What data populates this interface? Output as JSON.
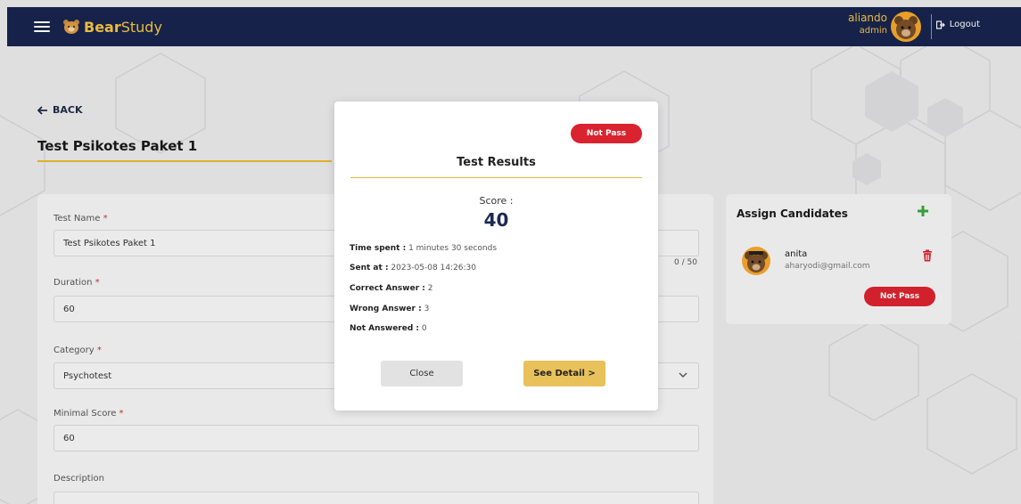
{
  "navbar": {
    "brand_bold": "Bear",
    "brand_light": "Study",
    "user_name": "aliando",
    "user_role": "admin",
    "logout_label": "Logout"
  },
  "page": {
    "back_label": "BACK",
    "title": "Test Psikotes Paket 1"
  },
  "form": {
    "test_name_label": "Test Name",
    "test_name_value": "Test Psikotes Paket 1",
    "test_name_counter": "0 / 50",
    "duration_label": "Duration",
    "duration_value": "60",
    "category_label": "Category",
    "category_value": "Psychotest",
    "minimal_score_label": "Minimal Score",
    "minimal_score_value": "60",
    "description_label": "Description",
    "required_mark": "*"
  },
  "assign": {
    "title": "Assign Candidates",
    "candidate_name": "anita",
    "candidate_email": "aharyodi@gmail.com",
    "candidate_status": "Not Pass"
  },
  "modal": {
    "status": "Not Pass",
    "title": "Test Results",
    "score_label": "Score :",
    "score_value": "40",
    "time_spent_label": "Time spent :",
    "time_spent_value": "1 minutes 30 seconds",
    "sent_at_label": "Sent at :",
    "sent_at_value": "2023-05-08 14:26:30",
    "correct_label": "Correct Answer :",
    "correct_value": "2",
    "wrong_label": "Wrong Answer :",
    "wrong_value": "3",
    "not_answered_label": "Not Answered :",
    "not_answered_value": "0",
    "close_label": "Close",
    "detail_label": "See Detail >"
  },
  "colors": {
    "navbar_bg": "#17244d",
    "brand_accent": "#f5c242",
    "danger": "#d9232e",
    "gold": "#e8b92e",
    "add_green": "#3aa53a"
  },
  "icons": {
    "menu": "hamburger-icon",
    "logout": "logout-icon",
    "back": "arrow-left-icon",
    "add": "plus-icon",
    "delete": "trash-icon",
    "select": "chevron-down-icon"
  }
}
